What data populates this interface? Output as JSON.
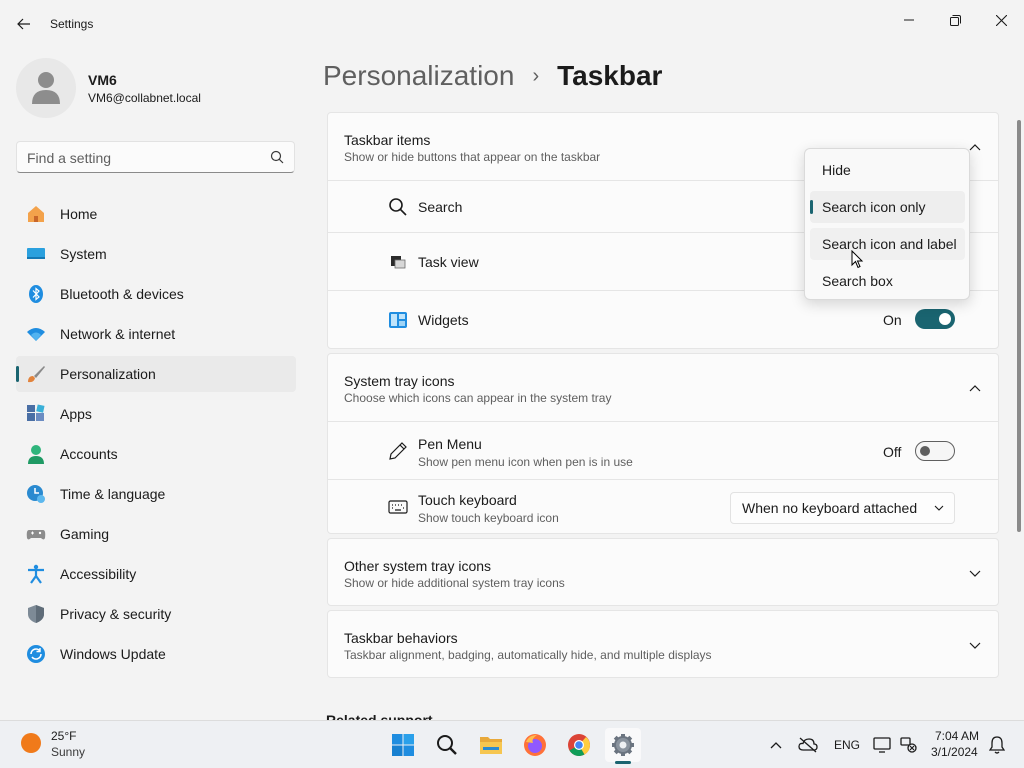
{
  "window": {
    "title": "Settings"
  },
  "profile": {
    "name": "VM6",
    "email": "VM6@collabnet.local"
  },
  "search": {
    "placeholder": "Find a setting"
  },
  "nav": {
    "items": [
      {
        "label": "Home",
        "icon": "home-icon"
      },
      {
        "label": "System",
        "icon": "system-icon"
      },
      {
        "label": "Bluetooth & devices",
        "icon": "bluetooth-icon"
      },
      {
        "label": "Network & internet",
        "icon": "wifi-icon"
      },
      {
        "label": "Personalization",
        "icon": "brush-icon",
        "selected": true
      },
      {
        "label": "Apps",
        "icon": "apps-icon"
      },
      {
        "label": "Accounts",
        "icon": "accounts-icon"
      },
      {
        "label": "Time & language",
        "icon": "time-language-icon"
      },
      {
        "label": "Gaming",
        "icon": "gaming-icon"
      },
      {
        "label": "Accessibility",
        "icon": "accessibility-icon"
      },
      {
        "label": "Privacy & security",
        "icon": "shield-icon"
      },
      {
        "label": "Windows Update",
        "icon": "update-icon"
      }
    ]
  },
  "breadcrumb": {
    "parent": "Personalization",
    "separator": "›",
    "current": "Taskbar"
  },
  "taskbar_items": {
    "title": "Taskbar items",
    "subtitle": "Show or hide buttons that appear on the taskbar",
    "rows": {
      "search": {
        "label": "Search"
      },
      "task_view": {
        "label": "Task view"
      },
      "widgets": {
        "label": "Widgets",
        "state": "On"
      }
    }
  },
  "search_flyout": {
    "options": [
      "Hide",
      "Search icon only",
      "Search icon and label",
      "Search box"
    ],
    "selected": "Search icon only",
    "hovered": "Search icon and label"
  },
  "system_tray": {
    "title": "System tray icons",
    "subtitle": "Choose which icons can appear in the system tray",
    "pen_menu": {
      "label": "Pen Menu",
      "sub": "Show pen menu icon when pen is in use",
      "state": "Off"
    },
    "touch_keyboard": {
      "label": "Touch keyboard",
      "sub": "Show touch keyboard icon",
      "value": "When no keyboard attached"
    }
  },
  "other_tray": {
    "title": "Other system tray icons",
    "subtitle": "Show or hide additional system tray icons"
  },
  "behaviors": {
    "title": "Taskbar behaviors",
    "subtitle": "Taskbar alignment, badging, automatically hide, and multiple displays"
  },
  "related": {
    "title": "Related support"
  },
  "taskbar": {
    "weather": {
      "temp": "25°F",
      "condition": "Sunny"
    },
    "apps": [
      "start-icon",
      "search-icon",
      "file-explorer-icon",
      "firefox-icon",
      "chrome-icon",
      "settings-icon"
    ],
    "lang": "ENG",
    "time": "7:04 AM",
    "date": "3/1/2024"
  },
  "colors": {
    "accent": "#1a6470",
    "background": "#f3f3f3",
    "card": "#fbfbfb"
  }
}
